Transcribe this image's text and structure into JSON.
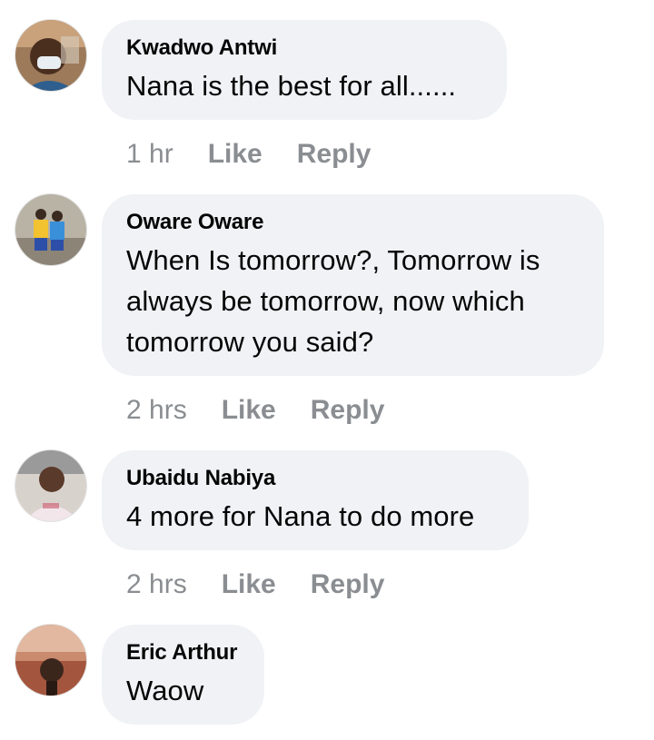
{
  "comments": [
    {
      "author": "Kwadwo Antwi",
      "text": "Nana is the best for all......",
      "time": "1 hr",
      "like_label": "Like",
      "reply_label": "Reply"
    },
    {
      "author": "Oware Oware",
      "text": "When Is tomorrow?, Tomorrow is always be tomorrow, now which tomorrow you said?",
      "time": "2 hrs",
      "like_label": "Like",
      "reply_label": "Reply"
    },
    {
      "author": "Ubaidu Nabiya",
      "text": "4 more for Nana to do more",
      "time": "2 hrs",
      "like_label": "Like",
      "reply_label": "Reply"
    },
    {
      "author": "Eric Arthur",
      "text": "Waow"
    }
  ],
  "colors": {
    "bubble": "#f0f2f5",
    "name": "#050505",
    "meta": "#8a8d91"
  }
}
